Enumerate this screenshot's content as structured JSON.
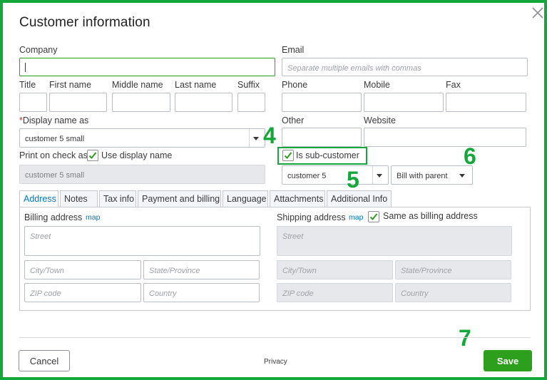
{
  "dialog": {
    "title": "Customer information"
  },
  "fields": {
    "company_label": "Company",
    "email_label": "Email",
    "email_placeholder": "Separate multiple emails with commas",
    "title_label": "Title",
    "first_name_label": "First name",
    "middle_name_label": "Middle name",
    "last_name_label": "Last name",
    "suffix_label": "Suffix",
    "phone_label": "Phone",
    "mobile_label": "Mobile",
    "fax_label": "Fax",
    "display_name_required": "*",
    "display_name_label": "Display name as",
    "display_name_value": "customer 5 small",
    "other_label": "Other",
    "website_label": "Website",
    "print_on_check_label": "Print on check as",
    "use_display_name_label": "Use display name",
    "print_on_check_value": "customer 5 small",
    "sub_customer_label": "Is sub-customer",
    "parent_customer_value": "customer 5",
    "bill_with_value": "Bill with parent"
  },
  "tabs": [
    {
      "label": "Address",
      "active": true
    },
    {
      "label": "Notes",
      "active": false
    },
    {
      "label": "Tax info",
      "active": false
    },
    {
      "label": "Payment and billing",
      "active": false
    },
    {
      "label": "Language",
      "active": false
    },
    {
      "label": "Attachments",
      "active": false
    },
    {
      "label": "Additional Info",
      "active": false
    }
  ],
  "address": {
    "billing_label": "Billing address",
    "map_link": "map",
    "shipping_label": "Shipping address",
    "same_as_billing_label": "Same as billing address",
    "street_placeholder": "Street",
    "city_placeholder": "City/Town",
    "state_placeholder": "State/Province",
    "zip_placeholder": "ZIP code",
    "country_placeholder": "Country"
  },
  "markers": [
    "4",
    "5",
    "6",
    "7"
  ],
  "footer": {
    "cancel_label": "Cancel",
    "privacy_label": "Privacy",
    "save_label": "Save"
  },
  "colors": {
    "annotation_green": "#14a83b",
    "save_green": "#2ca01c",
    "link_blue": "#0077c5"
  }
}
